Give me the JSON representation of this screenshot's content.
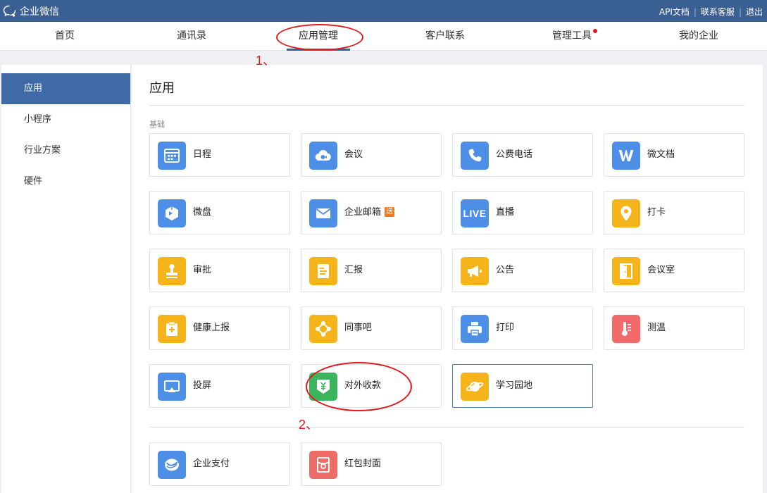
{
  "topbar": {
    "logo_text": "企业微信",
    "links": [
      "API文档",
      "联系客服",
      "退出"
    ]
  },
  "nav": {
    "items": [
      "首页",
      "通讯录",
      "应用管理",
      "客户联系",
      "管理工具",
      "我的企业"
    ],
    "active": "应用管理"
  },
  "sidebar": {
    "items": [
      "应用",
      "小程序",
      "行业方案",
      "硬件"
    ]
  },
  "main": {
    "title": "应用",
    "section_basic": "基础",
    "apps": [
      {
        "label": "日程",
        "icon": "calendar-icon",
        "color": "#4d8fe6"
      },
      {
        "label": "会议",
        "icon": "cloud-meeting-icon",
        "color": "#4d8fe6"
      },
      {
        "label": "公费电话",
        "icon": "phone-icon",
        "color": "#4d8fe6"
      },
      {
        "label": "微文档",
        "icon": "w-doc-icon",
        "color": "#4d8fe6"
      },
      {
        "label": "微盘",
        "icon": "drive-icon",
        "color": "#4d8fe6"
      },
      {
        "label": "企业邮箱",
        "icon": "mail-icon",
        "color": "#4d8fe6",
        "badge": "送"
      },
      {
        "label": "直播",
        "icon": "live-icon",
        "color": "#4d8fe6",
        "icon_text": "LIVE"
      },
      {
        "label": "打卡",
        "icon": "location-pin-icon",
        "color": "#f5b51a"
      },
      {
        "label": "审批",
        "icon": "stamp-icon",
        "color": "#f5b51a"
      },
      {
        "label": "汇报",
        "icon": "report-icon",
        "color": "#f5b51a"
      },
      {
        "label": "公告",
        "icon": "megaphone-icon",
        "color": "#f5b51a"
      },
      {
        "label": "会议室",
        "icon": "door-icon",
        "color": "#f5b51a"
      },
      {
        "label": "健康上报",
        "icon": "health-clipboard-icon",
        "color": "#f5b51a"
      },
      {
        "label": "同事吧",
        "icon": "network-icon",
        "color": "#f5b51a"
      },
      {
        "label": "打印",
        "icon": "printer-icon",
        "color": "#4d8fe6"
      },
      {
        "label": "测温",
        "icon": "thermometer-icon",
        "color": "#f26a6a"
      },
      {
        "label": "投屏",
        "icon": "screencast-icon",
        "color": "#4d8fe6"
      },
      {
        "label": "对外收款",
        "icon": "yuan-shield-icon",
        "color": "#3bb55c"
      },
      {
        "label": "学习园地",
        "icon": "planet-icon",
        "color": "#f5b51a"
      }
    ],
    "apps2": [
      {
        "label": "企业支付",
        "icon": "payment-icon",
        "color": "#4d8fe6"
      },
      {
        "label": "红包封面",
        "icon": "red-packet-icon",
        "color": "#ef6d67"
      }
    ]
  },
  "annotations": [
    "1、",
    "2、"
  ]
}
